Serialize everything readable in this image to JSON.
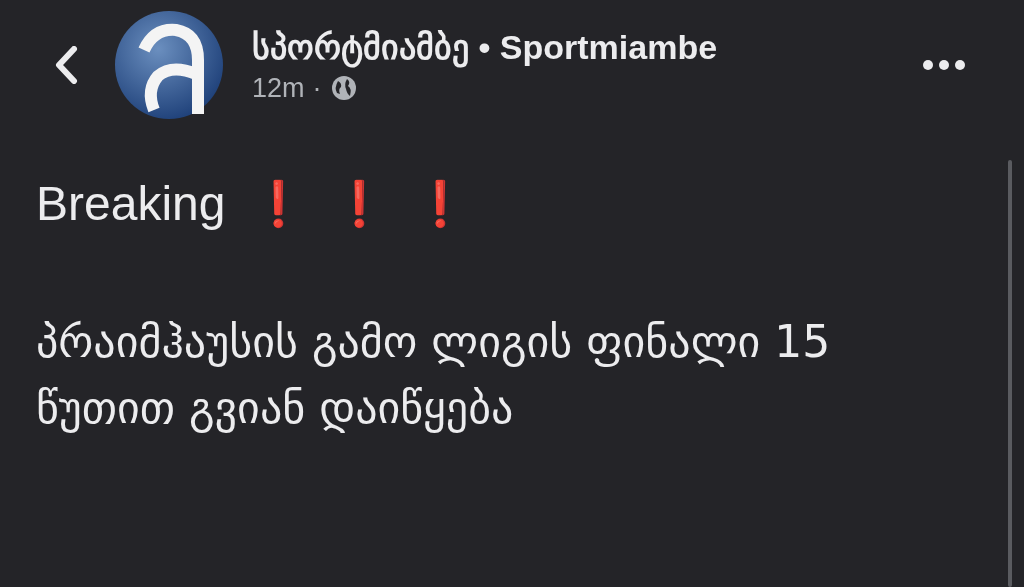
{
  "post": {
    "author": "სპორტმიამბე • Sportmiambe",
    "time": "12m",
    "separator": "·",
    "headline": "Breaking",
    "marks": [
      "❗",
      "❗",
      "❗"
    ],
    "body": "პრაიმჰაუსის გამო ლიგის ფინალი 15 წუთით გვიან დაიწყება"
  }
}
